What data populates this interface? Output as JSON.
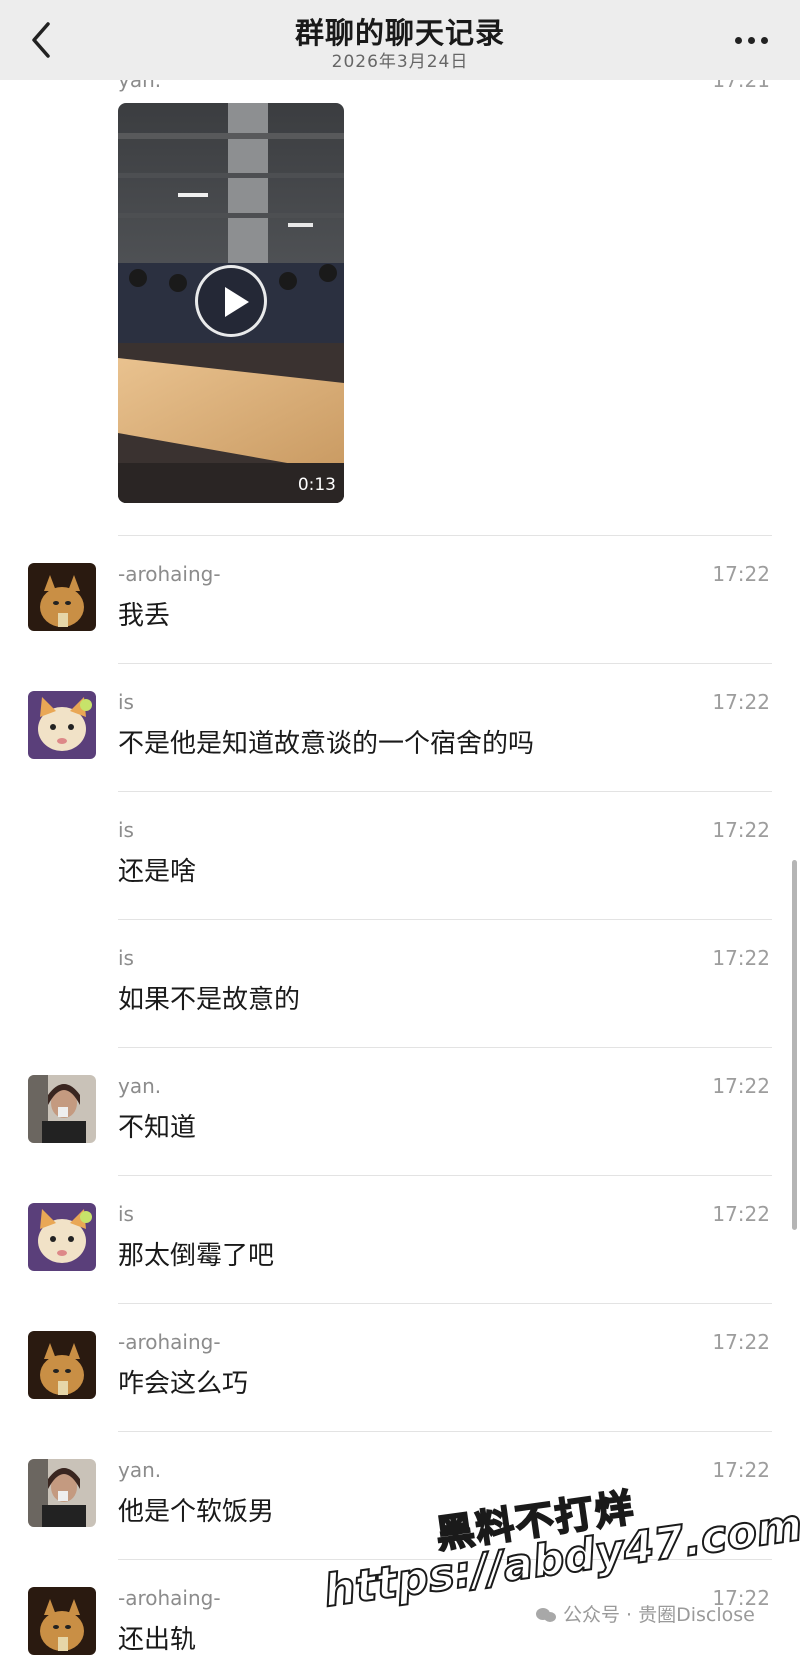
{
  "header": {
    "title": "群聊的聊天记录",
    "date": "2026年3月24日"
  },
  "first_message": {
    "sender": "yan.",
    "time": "17:21",
    "video_duration": "0:13"
  },
  "messages": [
    {
      "sender": "-arohaing-",
      "time": "17:22",
      "text": "我丢",
      "avatar": "cat-avatar"
    },
    {
      "sender": "is",
      "time": "17:22",
      "text": "不是他是知道故意谈的一个宿舍的吗",
      "avatar": "kitten-avatar"
    },
    {
      "sender": "is",
      "time": "17:22",
      "text": "还是啥",
      "avatar": ""
    },
    {
      "sender": "is",
      "time": "17:22",
      "text": "如果不是故意的",
      "avatar": ""
    },
    {
      "sender": "yan.",
      "time": "17:22",
      "text": "不知道",
      "avatar": "person-avatar"
    },
    {
      "sender": "is",
      "time": "17:22",
      "text": "那太倒霉了吧",
      "avatar": "kitten-avatar"
    },
    {
      "sender": "-arohaing-",
      "time": "17:22",
      "text": "咋会这么巧",
      "avatar": "cat-avatar"
    },
    {
      "sender": "yan.",
      "time": "17:22",
      "text": "他是个软饭男",
      "avatar": "person-avatar"
    },
    {
      "sender": "-arohaing-",
      "time": "17:22",
      "text": "还出轨",
      "avatar": "cat-avatar"
    }
  ],
  "watermark": {
    "line1": "黑料不打烊",
    "line2": "https://abdy47.com",
    "source": "公众号 · 贵圈Disclose"
  }
}
